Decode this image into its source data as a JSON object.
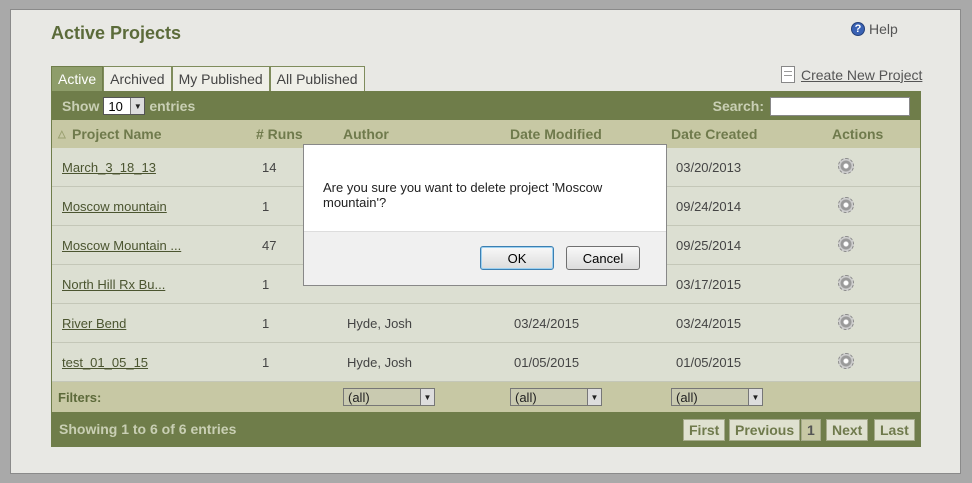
{
  "page": {
    "title": "Active Projects",
    "help_label": "Help",
    "create_label": "Create New Project"
  },
  "tabs": [
    "Active",
    "Archived",
    "My Published",
    "All Published"
  ],
  "table_controls": {
    "show_label": "Show",
    "entries_value": "10",
    "entries_label": "entries",
    "search_label": "Search:"
  },
  "columns": [
    "Project Name",
    "# Runs",
    "Author",
    "Date Modified",
    "Date Created",
    "Actions"
  ],
  "rows": [
    {
      "name": "March_3_18_13",
      "runs": "14",
      "author": "",
      "modified": "",
      "created": "03/20/2013"
    },
    {
      "name": "Moscow mountain",
      "runs": "1",
      "author": "",
      "modified": "",
      "created": "09/24/2014"
    },
    {
      "name": "Moscow Mountain ...",
      "runs": "47",
      "author": "",
      "modified": "",
      "created": "09/25/2014"
    },
    {
      "name": "North Hill Rx Bu...",
      "runs": "1",
      "author": "",
      "modified": "",
      "created": "03/17/2015"
    },
    {
      "name": "River Bend",
      "runs": "1",
      "author": "Hyde, Josh",
      "modified": "03/24/2015",
      "created": "03/24/2015"
    },
    {
      "name": "test_01_05_15",
      "runs": "1",
      "author": "Hyde, Josh",
      "modified": "01/05/2015",
      "created": "01/05/2015"
    }
  ],
  "filters": {
    "label": "Filters:",
    "author": "(all)",
    "modified": "(all)",
    "created": "(all)"
  },
  "footer": {
    "info": "Showing 1 to 6 of 6 entries",
    "first": "First",
    "previous": "Previous",
    "page": "1",
    "next": "Next",
    "last": "Last"
  },
  "dialog": {
    "message": "Are you sure you want to delete project 'Moscow mountain'?",
    "ok": "OK",
    "cancel": "Cancel"
  }
}
